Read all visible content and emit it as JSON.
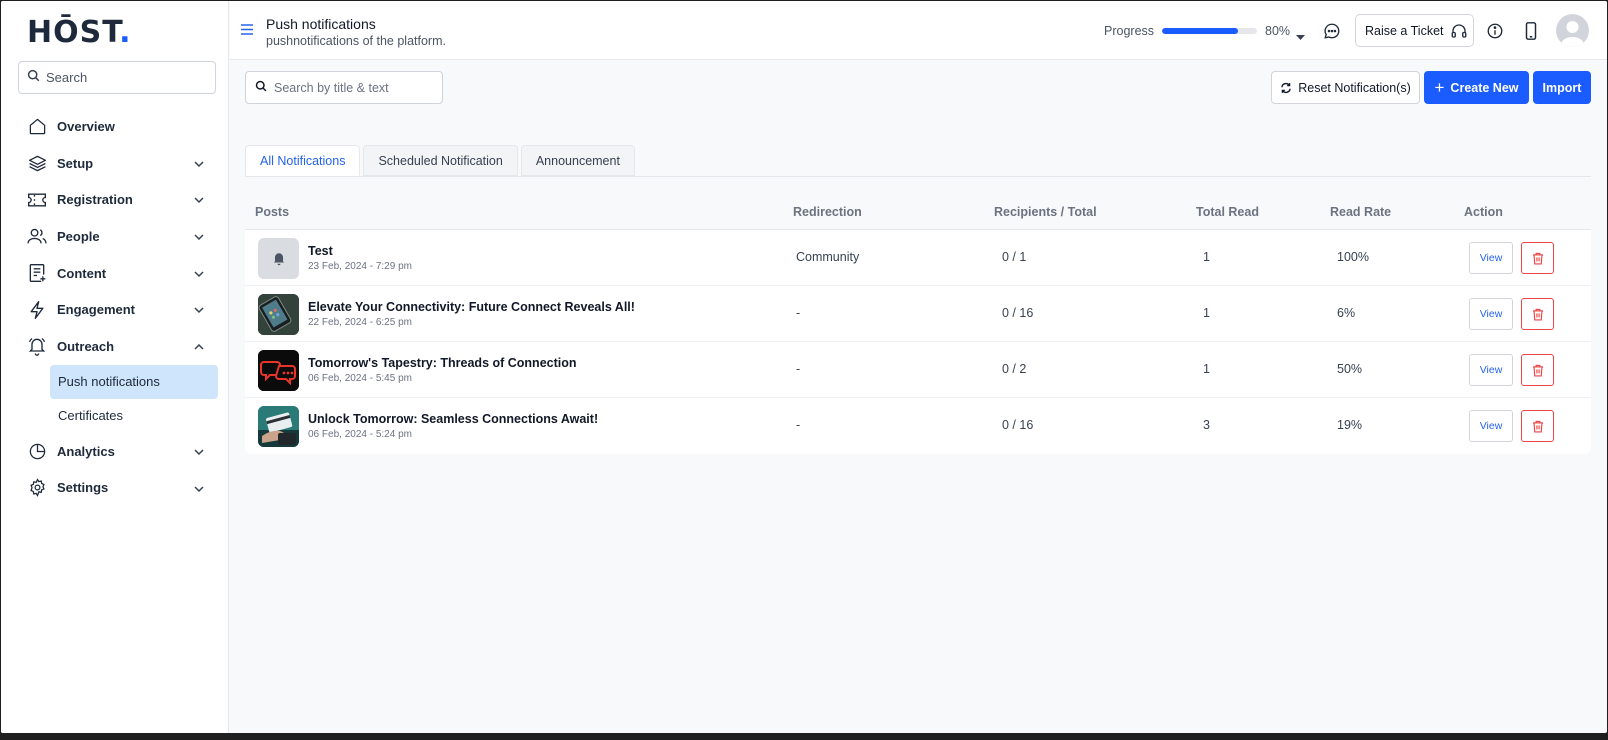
{
  "brand": {
    "logo_text": "HŌST",
    "logo_dot": "."
  },
  "sidebar": {
    "search_placeholder": "Search",
    "items": [
      {
        "label": "Overview",
        "icon": "home-icon"
      },
      {
        "label": "Setup",
        "icon": "layers-icon"
      },
      {
        "label": "Registration",
        "icon": "ticket-icon"
      },
      {
        "label": "People",
        "icon": "users-icon"
      },
      {
        "label": "Content",
        "icon": "document-plus-icon"
      },
      {
        "label": "Engagement",
        "icon": "bolt-icon"
      },
      {
        "label": "Outreach",
        "icon": "bell-icon"
      },
      {
        "label": "Analytics",
        "icon": "pie-chart-icon"
      },
      {
        "label": "Settings",
        "icon": "gear-icon"
      }
    ],
    "outreach_sub": [
      {
        "label": "Push notifications",
        "active": true
      },
      {
        "label": "Certificates",
        "active": false
      }
    ]
  },
  "header": {
    "title": "Push notifications",
    "subtitle": "pushnotifications of the platform.",
    "progress_label": "Progress",
    "progress_value": 80,
    "progress_text": "80%",
    "raise_ticket": "Raise a Ticket"
  },
  "toolbar": {
    "search_placeholder": "Search by title & text",
    "reset_label": "Reset Notification(s)",
    "create_label": "Create New",
    "import_label": "Import"
  },
  "tabs": [
    {
      "label": "All Notifications",
      "active": true
    },
    {
      "label": "Scheduled Notification",
      "active": false
    },
    {
      "label": "Announcement",
      "active": false
    }
  ],
  "table": {
    "columns": [
      "Posts",
      "Redirection",
      "Recipients / Total",
      "Total Read",
      "Read Rate",
      "Action"
    ],
    "view_label": "View",
    "rows": [
      {
        "title": "Test",
        "date": "23 Feb, 2024 - 7:29 pm",
        "redirection": "Community",
        "recipients": "0 / 1",
        "total_read": "1",
        "read_rate": "100%",
        "thumb": "bell"
      },
      {
        "title": "Elevate Your Connectivity: Future Connect Reveals All!",
        "date": "22 Feb, 2024 - 6:25 pm",
        "redirection": "-",
        "recipients": "0 / 16",
        "total_read": "1",
        "read_rate": "6%",
        "thumb": "phone"
      },
      {
        "title": "Tomorrow's Tapestry: Threads of Connection",
        "date": "06 Feb, 2024 - 5:45 pm",
        "redirection": "-",
        "recipients": "0 / 2",
        "total_read": "1",
        "read_rate": "50%",
        "thumb": "neon"
      },
      {
        "title": "Unlock Tomorrow: Seamless Connections Await!",
        "date": "06 Feb, 2024 - 5:24 pm",
        "redirection": "-",
        "recipients": "0 / 16",
        "total_read": "3",
        "read_rate": "19%",
        "thumb": "card"
      }
    ]
  },
  "colors": {
    "accent": "#1a5cff",
    "danger": "#ef4444",
    "active_sub_bg": "#cfe5fb"
  }
}
